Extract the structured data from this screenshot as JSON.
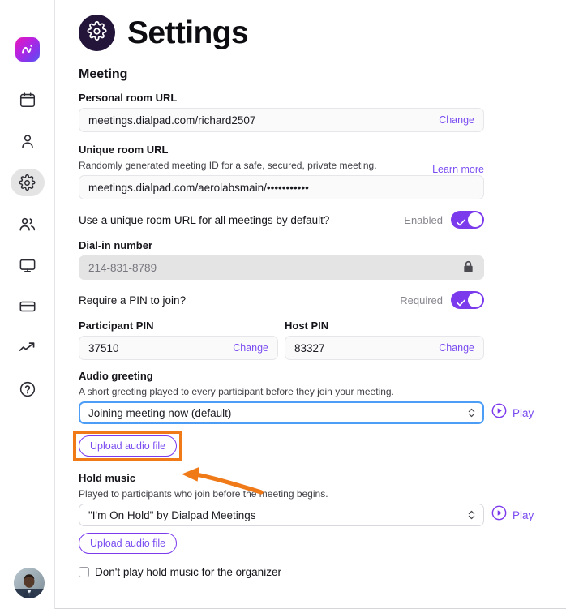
{
  "sidebar": {
    "logo_name": "dialpad-ai-logo",
    "items": [
      {
        "name": "calendar-icon",
        "label": "Calendar",
        "active": false
      },
      {
        "name": "person-icon",
        "label": "Contacts",
        "active": false
      },
      {
        "name": "gear-icon",
        "label": "Settings",
        "active": true
      },
      {
        "name": "people-icon",
        "label": "Teams",
        "active": false
      },
      {
        "name": "monitor-icon",
        "label": "Desktop",
        "active": false
      },
      {
        "name": "card-icon",
        "label": "Billing",
        "active": false
      },
      {
        "name": "trending-icon",
        "label": "Analytics",
        "active": false
      },
      {
        "name": "help-icon",
        "label": "Help",
        "active": false
      }
    ],
    "avatar_alt": "User avatar"
  },
  "header": {
    "badge_icon": "gear-icon",
    "title": "Settings"
  },
  "meeting": {
    "section_title": "Meeting",
    "personal_room": {
      "label": "Personal room URL",
      "value": "meetings.dialpad.com/richard2507",
      "action_label": "Change"
    },
    "unique_room": {
      "label": "Unique room URL",
      "description": "Randomly generated meeting ID for a safe, secured, private meeting.",
      "learn_more_label": "Learn more",
      "value": "meetings.dialpad.com/aerolabsmain/•••••••••••"
    },
    "unique_room_toggle": {
      "question": "Use a unique room URL for all meetings by default?",
      "state_label": "Enabled",
      "on": true
    },
    "dial_in": {
      "label": "Dial-in number",
      "value": "214-831-8789",
      "locked": true
    },
    "pin_toggle": {
      "question": "Require a PIN to join?",
      "state_label": "Required",
      "on": true
    },
    "participant_pin": {
      "label": "Participant PIN",
      "value": "37510",
      "action_label": "Change"
    },
    "host_pin": {
      "label": "Host PIN",
      "value": "83327",
      "action_label": "Change"
    },
    "audio_greeting": {
      "label": "Audio greeting",
      "description": "A short greeting played to every participant before they join your meeting.",
      "selected": "Joining meeting now (default)",
      "play_label": "Play",
      "upload_label": "Upload audio file"
    },
    "hold_music": {
      "label": "Hold music",
      "description": "Played to participants who join before the meeting begins.",
      "selected": "\"I'm On Hold\" by Dialpad Meetings",
      "play_label": "Play",
      "upload_label": "Upload audio file",
      "checkbox_label": "Don't play hold music for the organizer",
      "checkbox_checked": false
    }
  },
  "annotation": {
    "highlight_color": "#f07918",
    "arrow_color": "#f07918",
    "target": "Upload audio file"
  }
}
